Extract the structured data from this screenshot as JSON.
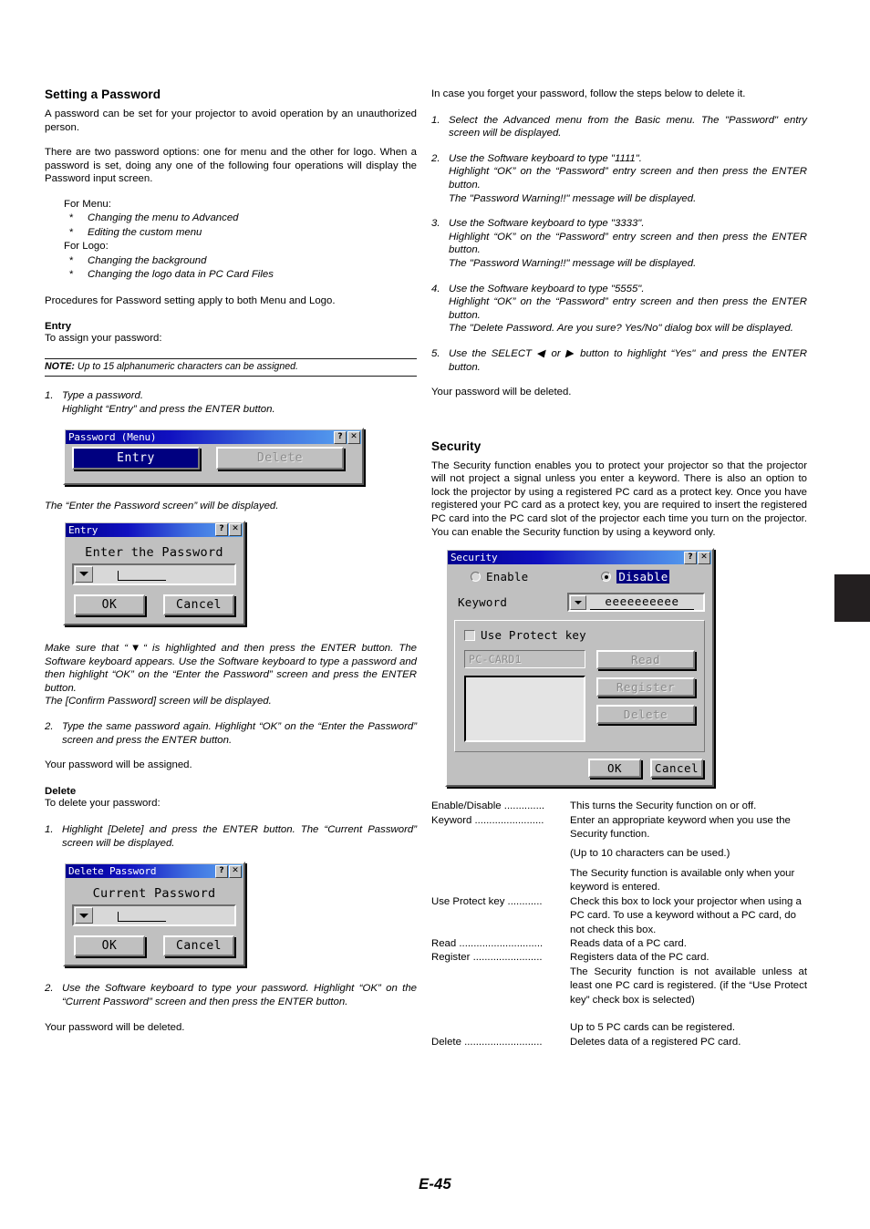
{
  "page": {
    "footer": "E-45"
  },
  "left": {
    "heading": "Setting a Password",
    "intro1": "A password can be set for your projector to avoid operation by an unauthorized person.",
    "intro2": "There are two password options: one for menu and the other for logo. When a password is set, doing any one of the following four operations will display the Password input screen.",
    "for_menu_label": "For Menu:",
    "for_menu_items": [
      "Changing the menu to Advanced",
      "Editing the custom menu"
    ],
    "for_logo_label": "For Logo:",
    "for_logo_items": [
      "Changing the background",
      "Changing the logo data in PC Card Files"
    ],
    "star": "*",
    "procedures": "Procedures for Password setting apply to both Menu and Logo.",
    "entry_heading": "Entry",
    "entry_sub": "To assign your password:",
    "note_label": "NOTE:",
    "note_text": " Up to 15 alphanumeric characters can be assigned.",
    "step1_num": "1.",
    "step1_line1": "Type a password.",
    "step1_line2": "Highlight “Entry” and press the ENTER button.",
    "after_menu_dialog": "The “Enter the Password screen” will be displayed.",
    "make_sure": "Make sure that “▼“ is highlighted and then press the ENTER button. The Software keyboard appears. Use the Software keyboard to type a password and then highlight “OK” on the “Enter the Password” screen and press the ENTER button.",
    "confirm_line": "The [Confirm Password] screen will be displayed.",
    "step2_num": "2.",
    "step2_text": "Type the same password again. Highlight “OK” on the “Enter the Password” screen and press the ENTER button.",
    "assigned": "Your password will be assigned.",
    "delete_heading": "Delete",
    "delete_sub": "To delete your password:",
    "del_step1_num": "1.",
    "del_step1_text": "Highlight [Delete] and press the ENTER button. The “Current Password” screen will be displayed.",
    "del_step2_num": "2.",
    "del_step2_text": "Use the Software keyboard to type your password. Highlight “OK” on the “Current Password” screen and then press the ENTER button.",
    "deleted": "Your password will be deleted."
  },
  "dialogs": {
    "password_menu": {
      "title": "Password (Menu)",
      "help_btn": "?",
      "close_btn": "✕",
      "entry_btn": "Entry",
      "delete_btn": "Delete"
    },
    "entry": {
      "title": "Entry",
      "help_btn": "?",
      "close_btn": "✕",
      "label": "Enter the Password",
      "value": "",
      "ok_btn": "OK",
      "cancel_btn": "Cancel"
    },
    "delete_password": {
      "title": "Delete Password",
      "help_btn": "?",
      "close_btn": "✕",
      "label": "Current Password",
      "value": "",
      "ok_btn": "OK",
      "cancel_btn": "Cancel"
    },
    "security": {
      "title": "Security",
      "help_btn": "?",
      "close_btn": "✕",
      "enable_label": "Enable",
      "disable_label": "Disable",
      "selected_option": "Disable",
      "keyword_label": "Keyword",
      "keyword_value": "eeeeeeeeee",
      "protect_key_label": "Use Protect key",
      "protect_key_checked": false,
      "card_name": "PC-CARD1",
      "read_btn": "Read",
      "register_btn": "Register",
      "delete_btn": "Delete",
      "ok_btn": "OK",
      "cancel_btn": "Cancel"
    }
  },
  "right": {
    "forgot_intro": "In case you forget your password, follow the steps below to delete it.",
    "steps": [
      {
        "num": "1.",
        "lines": [
          "Select the Advanced menu from the Basic menu. The \"Password\" entry screen will be displayed."
        ]
      },
      {
        "num": "2.",
        "lines": [
          "Use the Software keyboard to type \"1111\".",
          "Highlight “OK” on the “Password” entry screen and then press the ENTER button.",
          "The \"Password Warning!!\" message will be displayed."
        ]
      },
      {
        "num": "3.",
        "lines": [
          "Use the Software keyboard to type \"3333\".",
          "Highlight “OK” on the “Password” entry screen and then press the ENTER button.",
          "The \"Password Warning!!\" message will be displayed."
        ]
      },
      {
        "num": "4.",
        "lines": [
          "Use the Software keyboard to type \"5555\".",
          "Highlight “OK” on the “Password” entry screen and then press the ENTER button.",
          "The \"Delete Password. Are you sure? Yes/No\" dialog box will be displayed."
        ]
      },
      {
        "num": "5.",
        "lines": [
          "Use the SELECT ◀ or ▶ button to highlight “Yes\" and press the ENTER button."
        ]
      }
    ],
    "deleted": "Your password will be deleted.",
    "security_heading": "Security",
    "security_intro": "The Security function enables you to protect your projector so that the projector will not project a signal unless you enter a keyword. There is also an option to lock the projector by using a registered PC card as a protect key. Once you have registered your PC card as a protect key, you are required to insert the registered PC card into the PC card slot of the projector each time you turn on the projector. You can enable the Security function by using a keyword only.",
    "definitions": [
      {
        "term": "Enable/Disable ..............",
        "lines": [
          "This turns the Security function on or off."
        ]
      },
      {
        "term": "Keyword ........................",
        "lines": [
          "Enter an appropriate keyword when you use the Security function.",
          "(Up to 10 characters can be used.)",
          "The Security function is available only when your keyword is entered."
        ]
      },
      {
        "term": "Use Protect key ............",
        "lines": [
          "Check this box to lock your projector when using a PC card. To use a keyword without a PC card, do not check this box."
        ]
      },
      {
        "term": "Read .............................",
        "lines": [
          "Reads data of a PC card."
        ]
      },
      {
        "term": "Register ........................",
        "lines": [
          "Registers data of the PC card.",
          "The Security function is not available unless at least one PC card is registered. (if the “Use Protect key” check box is selected)",
          "Up to 5 PC cards can be registered."
        ]
      },
      {
        "term": "Delete ...........................",
        "lines": [
          "Deletes data of a registered PC card."
        ]
      }
    ]
  }
}
